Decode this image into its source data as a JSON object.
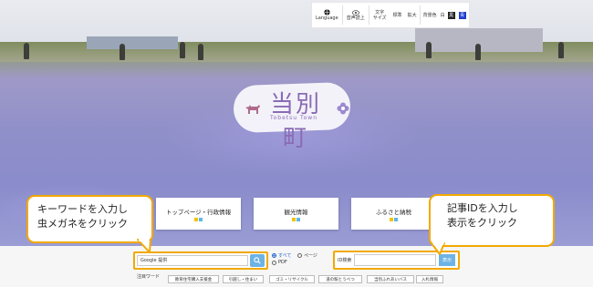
{
  "utility_bar": {
    "language": "Language",
    "voice": "音声読上",
    "font_size_label": "文字\nサイズ",
    "font_size_standard": "標準",
    "font_size_large": "拡大",
    "bg_color_label": "背景色",
    "bg_white": "白",
    "bg_black": "黒",
    "bg_blue": "青"
  },
  "logo": {
    "title": "当別町",
    "subtitle": "Tobetsu Town"
  },
  "nav_cards": [
    {
      "label": "トップページ・行政情報",
      "colors": [
        "#f2c200",
        "#5cb8e6"
      ]
    },
    {
      "label": "観光情報",
      "colors": [
        "#f2c200",
        "#5cb8e6"
      ]
    },
    {
      "label": "ふるさと納税",
      "colors": [
        "#f2c200",
        "#5cb8e6"
      ]
    }
  ],
  "search": {
    "placeholder": "Google 提供",
    "scope_all": "すべて",
    "scope_page": "ページ",
    "scope_pdf": "PDF"
  },
  "id_search": {
    "label": "ID検索",
    "button": "表示"
  },
  "tags": {
    "label": "注目ワード",
    "items": [
      "教育住宅購入支援金",
      "引越し・住まい",
      "ゴミ・リサイクル",
      "道の駅とうべつ",
      "当別ふれあいバス",
      "入札情報"
    ]
  },
  "callouts": {
    "left": [
      "キーワードを入力し",
      "虫メガネをクリック"
    ],
    "right": [
      "記事IDを入力し",
      "表示をクリック"
    ]
  },
  "colors": {
    "accent_orange": "#f2a900",
    "button_blue": "#6db3e6",
    "brand_purple": "#8a6bb5"
  }
}
